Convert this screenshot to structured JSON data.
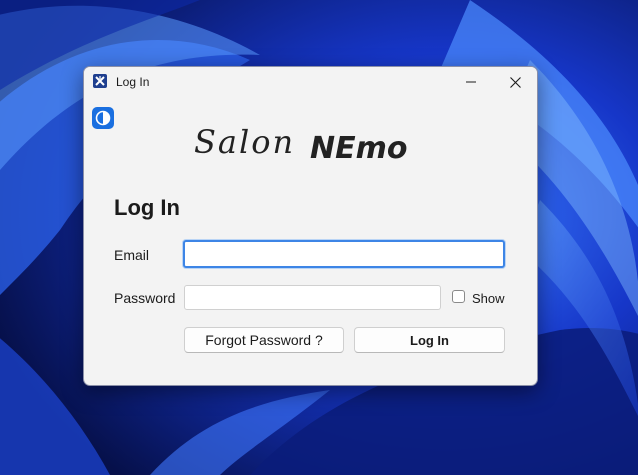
{
  "window": {
    "title": "Log In",
    "icon": "app-logo-icon",
    "minimize_icon": "minimize-icon",
    "close_icon": "close-icon"
  },
  "theme_toggle": {
    "icon": "half-circle-theme-icon"
  },
  "brand": {
    "part1": "Salon",
    "part2": "NEmo"
  },
  "form": {
    "heading": "Log In",
    "email_label": "Email",
    "email_value": "",
    "password_label": "Password",
    "password_value": "",
    "show_label": "Show",
    "show_checked": false,
    "forgot_label": "Forgot Password ?",
    "login_label": "Log In"
  },
  "colors": {
    "accent": "#3d85e6",
    "toggle_bg": "#1a6fe0",
    "window_bg": "#f3f3f3"
  }
}
